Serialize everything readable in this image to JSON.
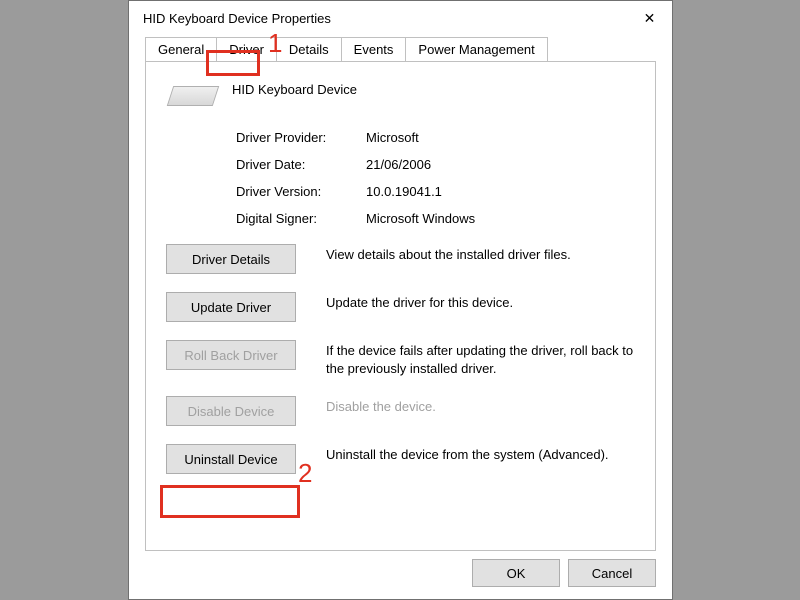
{
  "window": {
    "title": "HID Keyboard Device Properties"
  },
  "tabs": {
    "general": "General",
    "driver": "Driver",
    "details": "Details",
    "events": "Events",
    "power": "Power Management",
    "active": "Driver"
  },
  "device": {
    "name": "HID Keyboard Device"
  },
  "info": {
    "provider_label": "Driver Provider:",
    "provider_value": "Microsoft",
    "date_label": "Driver Date:",
    "date_value": "21/06/2006",
    "version_label": "Driver Version:",
    "version_value": "10.0.19041.1",
    "signer_label": "Digital Signer:",
    "signer_value": "Microsoft Windows"
  },
  "actions": {
    "details_btn": "Driver Details",
    "details_desc": "View details about the installed driver files.",
    "update_btn": "Update Driver",
    "update_desc": "Update the driver for this device.",
    "rollback_btn": "Roll Back Driver",
    "rollback_desc": "If the device fails after updating the driver, roll back to the previously installed driver.",
    "disable_btn": "Disable Device",
    "disable_desc": "Disable the device.",
    "uninstall_btn": "Uninstall Device",
    "uninstall_desc": "Uninstall the device from the system (Advanced)."
  },
  "footer": {
    "ok": "OK",
    "cancel": "Cancel"
  },
  "annotations": {
    "n1": "1",
    "n2": "2"
  }
}
